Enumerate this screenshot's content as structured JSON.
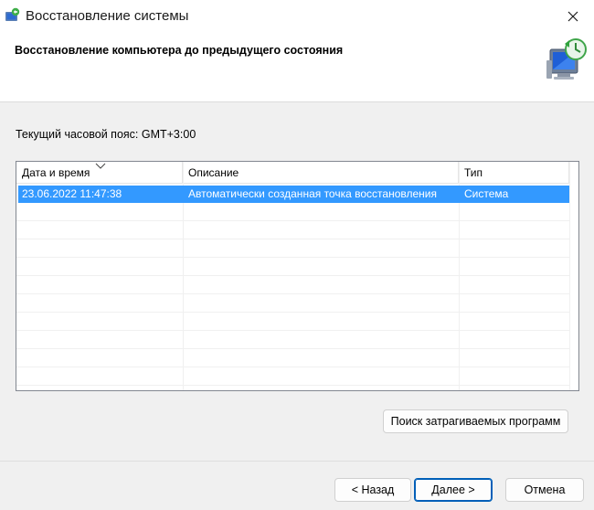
{
  "window": {
    "title": "Восстановление системы"
  },
  "header": {
    "title": "Восстановление компьютера до предыдущего состояния"
  },
  "timezone_label": "Текущий часовой пояс: GMT+3:00",
  "table": {
    "columns": [
      "Дата и время",
      "Описание",
      "Тип"
    ],
    "rows": [
      {
        "datetime": "23.06.2022 11:47:38",
        "description": "Автоматически созданная точка восстановления",
        "type": "Система",
        "selected": true
      }
    ]
  },
  "buttons": {
    "scan": "Поиск затрагиваемых программ",
    "back": "< Назад",
    "next": "Далее >",
    "cancel": "Отмена"
  },
  "colors": {
    "selection": "#3399ff",
    "accent": "#005fb8"
  }
}
